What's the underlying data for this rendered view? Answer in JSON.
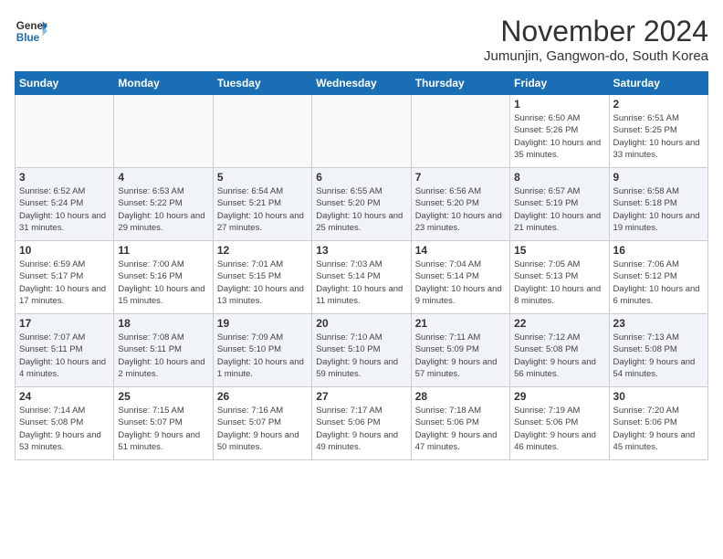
{
  "header": {
    "logo_line1": "General",
    "logo_line2": "Blue",
    "month_title": "November 2024",
    "location": "Jumunjin, Gangwon-do, South Korea"
  },
  "weekdays": [
    "Sunday",
    "Monday",
    "Tuesday",
    "Wednesday",
    "Thursday",
    "Friday",
    "Saturday"
  ],
  "weeks": [
    [
      {
        "day": "",
        "info": ""
      },
      {
        "day": "",
        "info": ""
      },
      {
        "day": "",
        "info": ""
      },
      {
        "day": "",
        "info": ""
      },
      {
        "day": "",
        "info": ""
      },
      {
        "day": "1",
        "info": "Sunrise: 6:50 AM\nSunset: 5:26 PM\nDaylight: 10 hours and 35 minutes."
      },
      {
        "day": "2",
        "info": "Sunrise: 6:51 AM\nSunset: 5:25 PM\nDaylight: 10 hours and 33 minutes."
      }
    ],
    [
      {
        "day": "3",
        "info": "Sunrise: 6:52 AM\nSunset: 5:24 PM\nDaylight: 10 hours and 31 minutes."
      },
      {
        "day": "4",
        "info": "Sunrise: 6:53 AM\nSunset: 5:22 PM\nDaylight: 10 hours and 29 minutes."
      },
      {
        "day": "5",
        "info": "Sunrise: 6:54 AM\nSunset: 5:21 PM\nDaylight: 10 hours and 27 minutes."
      },
      {
        "day": "6",
        "info": "Sunrise: 6:55 AM\nSunset: 5:20 PM\nDaylight: 10 hours and 25 minutes."
      },
      {
        "day": "7",
        "info": "Sunrise: 6:56 AM\nSunset: 5:20 PM\nDaylight: 10 hours and 23 minutes."
      },
      {
        "day": "8",
        "info": "Sunrise: 6:57 AM\nSunset: 5:19 PM\nDaylight: 10 hours and 21 minutes."
      },
      {
        "day": "9",
        "info": "Sunrise: 6:58 AM\nSunset: 5:18 PM\nDaylight: 10 hours and 19 minutes."
      }
    ],
    [
      {
        "day": "10",
        "info": "Sunrise: 6:59 AM\nSunset: 5:17 PM\nDaylight: 10 hours and 17 minutes."
      },
      {
        "day": "11",
        "info": "Sunrise: 7:00 AM\nSunset: 5:16 PM\nDaylight: 10 hours and 15 minutes."
      },
      {
        "day": "12",
        "info": "Sunrise: 7:01 AM\nSunset: 5:15 PM\nDaylight: 10 hours and 13 minutes."
      },
      {
        "day": "13",
        "info": "Sunrise: 7:03 AM\nSunset: 5:14 PM\nDaylight: 10 hours and 11 minutes."
      },
      {
        "day": "14",
        "info": "Sunrise: 7:04 AM\nSunset: 5:14 PM\nDaylight: 10 hours and 9 minutes."
      },
      {
        "day": "15",
        "info": "Sunrise: 7:05 AM\nSunset: 5:13 PM\nDaylight: 10 hours and 8 minutes."
      },
      {
        "day": "16",
        "info": "Sunrise: 7:06 AM\nSunset: 5:12 PM\nDaylight: 10 hours and 6 minutes."
      }
    ],
    [
      {
        "day": "17",
        "info": "Sunrise: 7:07 AM\nSunset: 5:11 PM\nDaylight: 10 hours and 4 minutes."
      },
      {
        "day": "18",
        "info": "Sunrise: 7:08 AM\nSunset: 5:11 PM\nDaylight: 10 hours and 2 minutes."
      },
      {
        "day": "19",
        "info": "Sunrise: 7:09 AM\nSunset: 5:10 PM\nDaylight: 10 hours and 1 minute."
      },
      {
        "day": "20",
        "info": "Sunrise: 7:10 AM\nSunset: 5:10 PM\nDaylight: 9 hours and 59 minutes."
      },
      {
        "day": "21",
        "info": "Sunrise: 7:11 AM\nSunset: 5:09 PM\nDaylight: 9 hours and 57 minutes."
      },
      {
        "day": "22",
        "info": "Sunrise: 7:12 AM\nSunset: 5:08 PM\nDaylight: 9 hours and 56 minutes."
      },
      {
        "day": "23",
        "info": "Sunrise: 7:13 AM\nSunset: 5:08 PM\nDaylight: 9 hours and 54 minutes."
      }
    ],
    [
      {
        "day": "24",
        "info": "Sunrise: 7:14 AM\nSunset: 5:08 PM\nDaylight: 9 hours and 53 minutes."
      },
      {
        "day": "25",
        "info": "Sunrise: 7:15 AM\nSunset: 5:07 PM\nDaylight: 9 hours and 51 minutes."
      },
      {
        "day": "26",
        "info": "Sunrise: 7:16 AM\nSunset: 5:07 PM\nDaylight: 9 hours and 50 minutes."
      },
      {
        "day": "27",
        "info": "Sunrise: 7:17 AM\nSunset: 5:06 PM\nDaylight: 9 hours and 49 minutes."
      },
      {
        "day": "28",
        "info": "Sunrise: 7:18 AM\nSunset: 5:06 PM\nDaylight: 9 hours and 47 minutes."
      },
      {
        "day": "29",
        "info": "Sunrise: 7:19 AM\nSunset: 5:06 PM\nDaylight: 9 hours and 46 minutes."
      },
      {
        "day": "30",
        "info": "Sunrise: 7:20 AM\nSunset: 5:06 PM\nDaylight: 9 hours and 45 minutes."
      }
    ]
  ]
}
